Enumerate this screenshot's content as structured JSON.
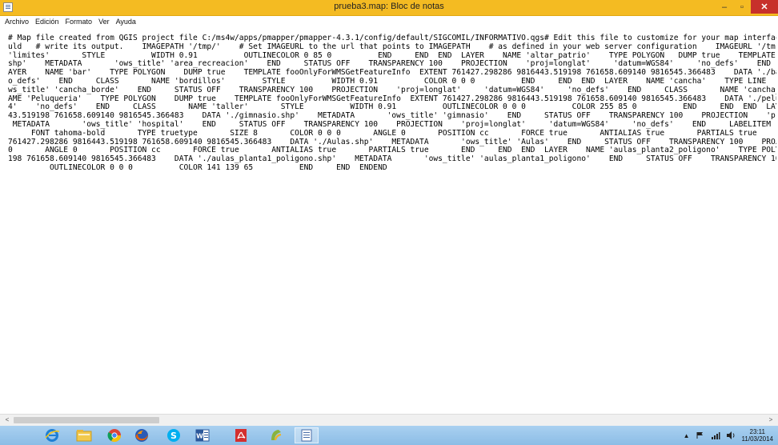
{
  "window": {
    "title": "prueba3.map: Bloc de notas",
    "minimize_glyph": "–",
    "maximize_glyph": "▫",
    "close_glyph": "✕"
  },
  "menu": [
    {
      "label": "Archivo"
    },
    {
      "label": "Edición"
    },
    {
      "label": "Formato"
    },
    {
      "label": "Ver"
    },
    {
      "label": "Ayuda"
    }
  ],
  "editor": {
    "lines": [
      "# Map file created from QGIS project file C:/ms4w/apps/pmapper/pmapper-4.3.1/config/default/SIGCOMIL/INFORMATIVO.qgs# Edit this file to customize for your map interfac",
      "uld   # write its output.    IMAGEPATH '/tmp/'    # Set IMAGEURL to the url that points to IMAGEPATH    # as defined in your web server configuration    IMAGEURL '/tm",
      "'limites'       STYLE          WIDTH 0.91          OUTLINECOLOR 0 85 0          END     END  END  LAYER    NAME 'altar_patrio'    TYPE POLYGON   DUMP true    TEMPLATE foo",
      "shp'    METADATA       'ows_title' 'area_recreacion'    END     STATUS OFF    TRANSPARENCY 100    PROJECTION    'proj=longlat'     'datum=WGS84'     'no_defs'    END     LA",
      "AYER    NAME 'bar'    TYPE POLYGON    DUMP true    TEMPLATE fooOnlyForWMSGetFeatureInfo  EXTENT 761427.298286 9816443.519198 761658.609140 9816545.366483    DATA './ba",
      "o_defs'    END     CLASS       NAME 'bordillos'        STYLE          WIDTH 0.91          COLOR 0 0 0          END     END  END  LAYER    NAME 'cancha'    TYPE LINE    DUMP",
      "ws_title' 'cancha_borde'    END     STATUS OFF    TRANSPARENCY 100    PROJECTION    'proj=longlat'     'datum=WGS84'     'no_defs'    END     CLASS       NAME 'cancha_bord",
      "AME 'Peluqueria'    TYPE POLYGON    DUMP true    TEMPLATE fooOnlyForWMSGetFeatureInfo  EXTENT 761427.298286 9816443.519198 761658.609140 9816545.366483    DATA './pelu",
      "4'    'no_defs'    END     CLASS       NAME 'taller'       STYLE          WIDTH 0.91          OUTLINECOLOR 0 0 0          COLOR 255 85 0          END     END  END  LAYER",
      "43.519198 761658.609140 9816545.366483    DATA './gimnasio.shp'    METADATA       'ows_title' 'gimnasio'    END     STATUS OFF    TRANSPARENCY 100    PROJECTION    'proj",
      " METADATA       'ows_title' 'hospital'    END     STATUS OFF    TRANSPARENCY 100    PROJECTION    'proj=longlat'     'datum=WGS84'     'no_defs'    END     LABELITEM 'Layer",
      "     FONT tahoma-bold       TYPE truetype       SIZE 8       COLOR 0 0 0       ANGLE 0       POSITION cc       FORCE true       ANTIALIAS true       PARTIALS true       END",
      "761427.298286 9816443.519198 761658.609140 9816545.366483    DATA './Aulas.shp'    METADATA       'ows_title' 'Aulas'    END     STATUS OFF    TRANSPARENCY 100    PROJEC",
      "0       ANGLE 0       POSITION cc       FORCE true       ANTIALIAS true       PARTIALS true       END     END  END  LAYER    NAME 'aulas_planta2_poligono'    TYPE POLYGON",
      "198 761658.609140 9816545.366483    DATA './aulas_planta1_poligono.shp'    METADATA       'ows_title' 'aulas_planta1_poligono'    END     STATUS OFF    TRANSPARENCY 100",
      "         OUTLINECOLOR 0 0 0          COLOR 141 139 65          END     END  ENDEND"
    ]
  },
  "scrollbar": {
    "left_arrow": "<",
    "right_arrow": ">"
  },
  "taskbar": {
    "apps": [
      {
        "icon": "internet-explorer-icon"
      },
      {
        "icon": "file-explorer-icon"
      },
      {
        "icon": "chrome-icon"
      },
      {
        "icon": "firefox-icon"
      },
      {
        "icon": "skype-icon"
      },
      {
        "icon": "word-icon"
      },
      {
        "icon": "acrobat-icon"
      },
      {
        "icon": "qgis-icon"
      },
      {
        "icon": "notepad-icon"
      }
    ],
    "clock": {
      "time": "23:11",
      "date": "11/03/2014"
    }
  },
  "colors": {
    "titlebar": "#f4bb22",
    "close_button": "#c7302b",
    "taskbar": "#a9d0f0"
  }
}
